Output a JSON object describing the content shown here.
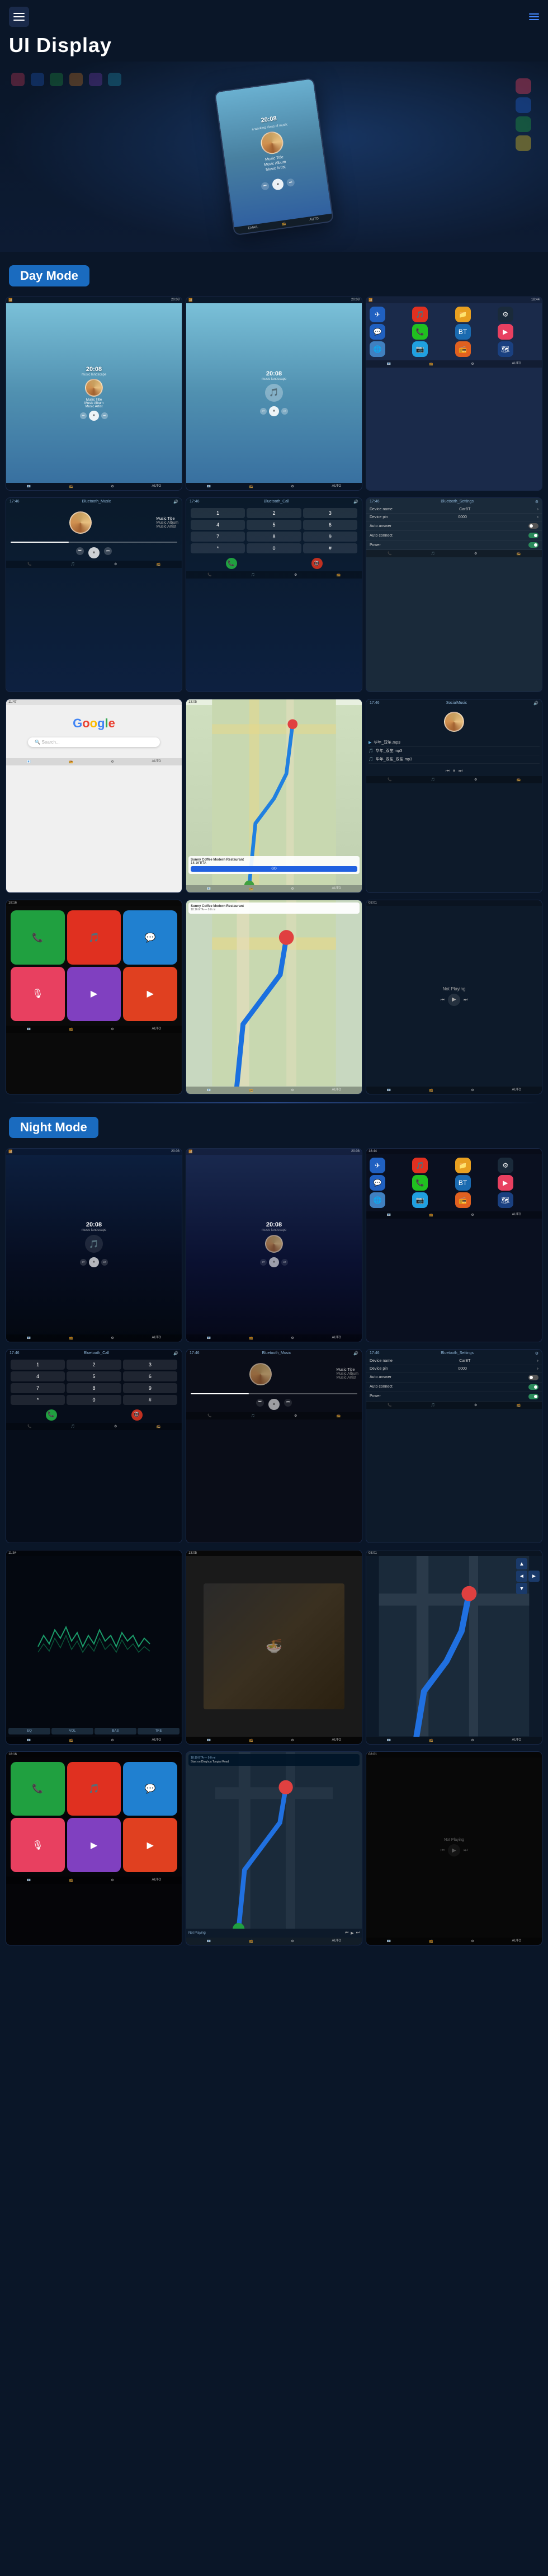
{
  "header": {
    "title": "UI Display",
    "menu_label": "menu",
    "nav_label": "navigation"
  },
  "sections": {
    "day_mode": "Day Mode",
    "night_mode": "Night Mode"
  },
  "day_screens": {
    "music1": {
      "time": "20:08",
      "subtitle": "music landscape",
      "track": "Music Title",
      "album": "Music Album",
      "artist": "Music Artist"
    },
    "music2": {
      "time": "20:08",
      "subtitle": "music landscape"
    },
    "bluetooth_music": {
      "header": "Bluetooth_Music",
      "track": "Music Title",
      "album": "Music Album",
      "artist": "Music Artist"
    },
    "bluetooth_call": {
      "header": "Bluetooth_Call",
      "nums": [
        "1",
        "2",
        "3",
        "4",
        "5",
        "6",
        "7",
        "8",
        "9",
        "*",
        "0",
        "#"
      ]
    },
    "bluetooth_settings": {
      "header": "Bluetooth_Settings",
      "fields": [
        {
          "label": "Device name",
          "value": "CarBT"
        },
        {
          "label": "Device pin",
          "value": "0000"
        },
        {
          "label": "Auto answer",
          "value": ""
        },
        {
          "label": "Auto connect",
          "value": ""
        },
        {
          "label": "Power",
          "value": ""
        }
      ]
    },
    "google": {
      "logo": "Google",
      "search_placeholder": "Search..."
    },
    "map": {
      "restaurant": "Sunny Coffee Modern Restaurant"
    },
    "social_music": {
      "header": "SocialMusic",
      "tracks": [
        "华年_双笙.mp3",
        "华年_双笙.mp3",
        "华年_双笙_双笙.mp3"
      ]
    }
  },
  "night_screens": {
    "music1": {
      "time": "20:08",
      "subtitle": "music landscape"
    },
    "music2": {
      "time": "20:08",
      "subtitle": "music landscape"
    },
    "bluetooth_call": {
      "header": "Bluetooth_Call"
    },
    "bluetooth_music": {
      "header": "Bluetooth_Music",
      "track": "Music Title",
      "album": "Music Album",
      "artist": "Music Artist"
    },
    "bluetooth_settings": {
      "header": "Bluetooth_Settings",
      "fields": [
        {
          "label": "Device name",
          "value": "CarBT"
        },
        {
          "label": "Device pin",
          "value": "0000"
        },
        {
          "label": "Auto answer",
          "value": ""
        },
        {
          "label": "Auto connect",
          "value": ""
        },
        {
          "label": "Power",
          "value": ""
        }
      ]
    }
  },
  "app_colors": {
    "phone": "#2a9a3a",
    "messages": "#2a9a3a",
    "maps": "#4a8ad0",
    "music": "#e84060",
    "settings": "#888",
    "bluetooth": "#2060c0",
    "wifi": "#20a0e0",
    "radio": "#e06020",
    "camera": "#888",
    "youtube": "#e02020",
    "podcast": "#8040c0"
  }
}
